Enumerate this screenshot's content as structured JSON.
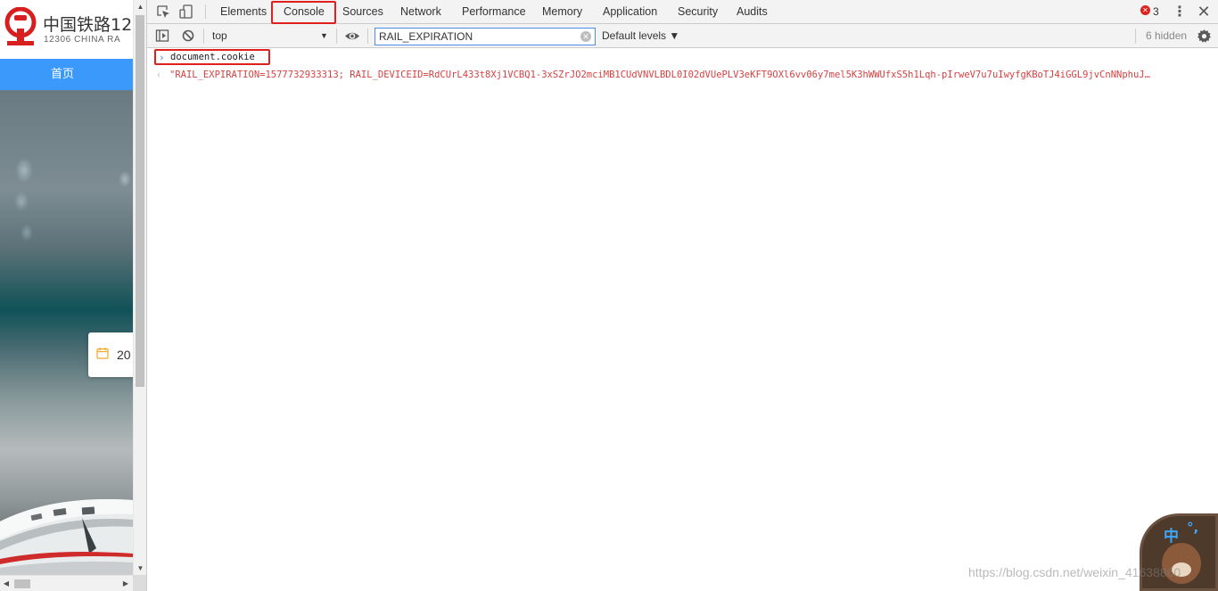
{
  "page": {
    "logo_title": "中国铁路12",
    "logo_subtitle": "12306 CHINA RA",
    "nav_home": "首页",
    "date_partial": "20"
  },
  "devtools": {
    "tabs": [
      "Elements",
      "Console",
      "Sources",
      "Network",
      "Performance",
      "Memory",
      "Application",
      "Security",
      "Audits"
    ],
    "active_tab": "Console",
    "error_count": "3",
    "toolbar": {
      "context": "top",
      "filter_value": "RAIL_EXPIRATION",
      "levels": "Default levels ▼",
      "hidden": "6 hidden"
    },
    "console": {
      "input": "document.cookie",
      "output": "\"RAIL_EXPIRATION=1577732933313; RAIL_DEVICEID=RdCUrL433t8Xj1VCBQ1-3xSZrJO2mciMB1CUdVNVLBDL0I02dVUePLV3eKFT9OXl6vv06y7mel5K3hWWUfxS5h1Lqh-pIrweV7u7uIwyfgKBoTJ4iGGL9jvCnNNphuJ…"
    }
  },
  "overlay": {
    "ime_char": "中",
    "ime_punct": "°,",
    "watermark": "https://blog.csdn.net/weixin_41638860"
  },
  "colors": {
    "nav_blue": "#3b99fc",
    "highlight_red": "#e0201e",
    "console_output_red": "#c80000",
    "filter_focus_blue": "#4b8de8"
  },
  "icons": [
    "inspect-icon",
    "device-toolbar-icon",
    "sidebar-toggle-icon",
    "clear-console-icon",
    "eye-icon",
    "settings-icon",
    "calendar-icon",
    "railway-logo-icon",
    "error-icon",
    "kebab-menu-icon",
    "close-icon"
  ]
}
